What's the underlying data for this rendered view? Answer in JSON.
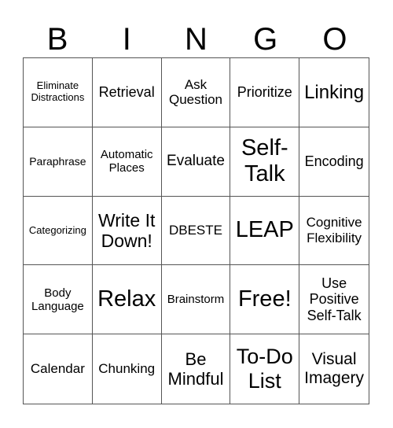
{
  "header": {
    "letters": [
      "B",
      "I",
      "N",
      "G",
      "O"
    ]
  },
  "board": {
    "rows": [
      [
        {
          "text": "Eliminate Distractions",
          "size": "s13"
        },
        {
          "text": "Retrieval",
          "size": "s18"
        },
        {
          "text": "Ask Question",
          "size": "s17"
        },
        {
          "text": "Prioritize",
          "size": "s18"
        },
        {
          "text": "Linking",
          "size": "s24"
        }
      ],
      [
        {
          "text": "Paraphrase",
          "size": "s14"
        },
        {
          "text": "Automatic Places",
          "size": "s15"
        },
        {
          "text": "Evaluate",
          "size": "s19"
        },
        {
          "text": "Self-Talk",
          "size": "s29"
        },
        {
          "text": "Encoding",
          "size": "s18"
        }
      ],
      [
        {
          "text": "Categorizing",
          "size": "s13"
        },
        {
          "text": "Write It Down!",
          "size": "s23"
        },
        {
          "text": "DBESTE",
          "size": "s17"
        },
        {
          "text": "LEAP",
          "size": "s29"
        },
        {
          "text": "Cognitive Flexibility",
          "size": "s17"
        }
      ],
      [
        {
          "text": "Body Language",
          "size": "s15"
        },
        {
          "text": "Relax",
          "size": "s29"
        },
        {
          "text": "Brainstorm",
          "size": "s15"
        },
        {
          "text": "Free!",
          "size": "s29"
        },
        {
          "text": "Use Positive Self-Talk",
          "size": "s18"
        }
      ],
      [
        {
          "text": "Calendar",
          "size": "s17"
        },
        {
          "text": "Chunking",
          "size": "s17"
        },
        {
          "text": "Be Mindful",
          "size": "s22"
        },
        {
          "text": "To-Do List",
          "size": "s27"
        },
        {
          "text": "Visual Imagery",
          "size": "s21"
        }
      ]
    ]
  },
  "colors": {
    "background": "#ffffff",
    "text": "#000000",
    "grid_line": "#555555"
  }
}
